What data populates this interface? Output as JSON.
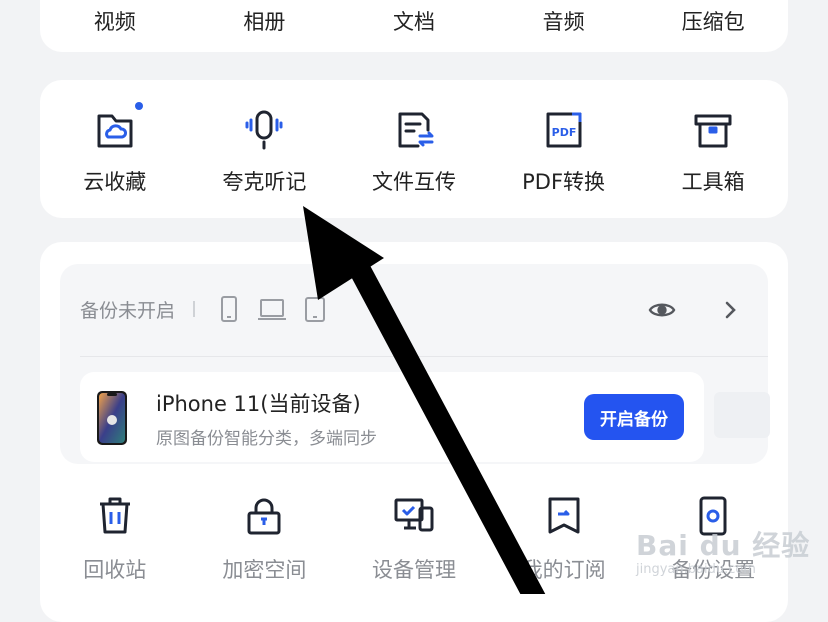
{
  "top_row": [
    {
      "label": "视频"
    },
    {
      "label": "相册"
    },
    {
      "label": "文档"
    },
    {
      "label": "音频"
    },
    {
      "label": "压缩包"
    }
  ],
  "tools": [
    {
      "label": "云收藏",
      "icon": "cloud-folder-icon",
      "badge": "dot"
    },
    {
      "label": "夸克听记",
      "icon": "microphone-icon"
    },
    {
      "label": "文件互传",
      "icon": "file-transfer-icon"
    },
    {
      "label": "PDF转换",
      "icon": "pdf-icon"
    },
    {
      "label": "工具箱",
      "icon": "toolbox-icon"
    }
  ],
  "backup": {
    "status": "备份未开启",
    "device_name": "iPhone 11(当前设备)",
    "device_desc": "原图备份智能分类，多端同步",
    "button": "开启备份"
  },
  "bottom_row": [
    {
      "label": "回收站",
      "icon": "trash-icon"
    },
    {
      "label": "加密空间",
      "icon": "lock-icon"
    },
    {
      "label": "设备管理",
      "icon": "devices-icon"
    },
    {
      "label": "我的订阅",
      "icon": "bookmark-icon"
    },
    {
      "label": "备份设置",
      "icon": "backup-settings-icon"
    }
  ],
  "watermark": {
    "big": "Bai du 经验",
    "small": "jingyan.baidu.com"
  },
  "colors": {
    "accent": "#2454f0",
    "icon_blue": "#2a5ee8",
    "text": "#222222",
    "muted": "#8a8d93"
  }
}
